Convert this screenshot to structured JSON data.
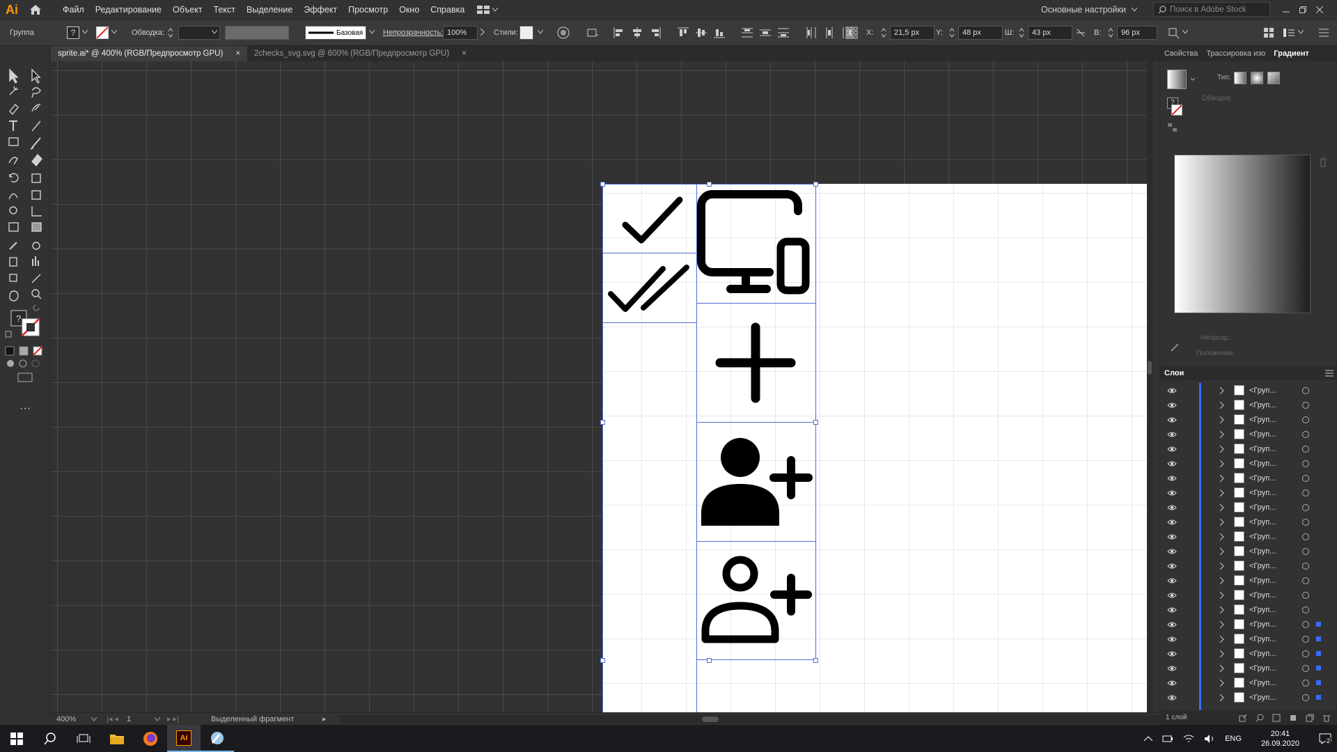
{
  "app": {
    "logo": "Ai"
  },
  "menu": {
    "items": [
      "Файл",
      "Редактирование",
      "Объект",
      "Текст",
      "Выделение",
      "Эффект",
      "Просмотр",
      "Окно",
      "Справка"
    ]
  },
  "workspace": {
    "label": "Основные настройки"
  },
  "stock_search": {
    "placeholder": "Поиск в Adobe Stock"
  },
  "control_bar": {
    "selection_type": "Группа",
    "stroke_label": "Обводка:",
    "stroke_profile": "Базовая",
    "opacity_label": "Непрозрачность:",
    "opacity_value": "100%",
    "style_label": "Стили:",
    "x_label": "X:",
    "x_value": "21,5 px",
    "y_label": "Y:",
    "y_value": "48 px",
    "w_label": "Ш:",
    "w_value": "43 px",
    "h_label": "В:",
    "h_value": "96 px"
  },
  "tabs": [
    {
      "label": "sprite.ai* @ 400% (RGB/Предпросмотр GPU)",
      "active": true
    },
    {
      "label": "2checks_svg.svg @ 600% (RGB/Предпросмотр GPU)",
      "active": false
    }
  ],
  "canvas": {
    "icons": [
      "check-icon",
      "double-check-icon",
      "monitor-phone-icon",
      "plus-icon",
      "user-add-filled-icon",
      "user-add-outline-icon"
    ]
  },
  "status_bar": {
    "zoom": "400%",
    "artboard_number": "1",
    "status_text": "Выделенный фрагмент"
  },
  "right_panel": {
    "tabs": [
      "Свойства",
      "Трассировка изо",
      "Градиент"
    ],
    "gradient": {
      "type_label": "Тип:",
      "stroke_label": "Обводка:",
      "opacity_label": "Непрозр.:",
      "position_label": "Положение:"
    },
    "layers_title": "Слои",
    "layer_name": "<Груп...",
    "layers_count": "1 слой"
  },
  "taskbar": {
    "language": "ENG",
    "time": "20:41",
    "date": "26.09.2020",
    "notifications": "2"
  }
}
